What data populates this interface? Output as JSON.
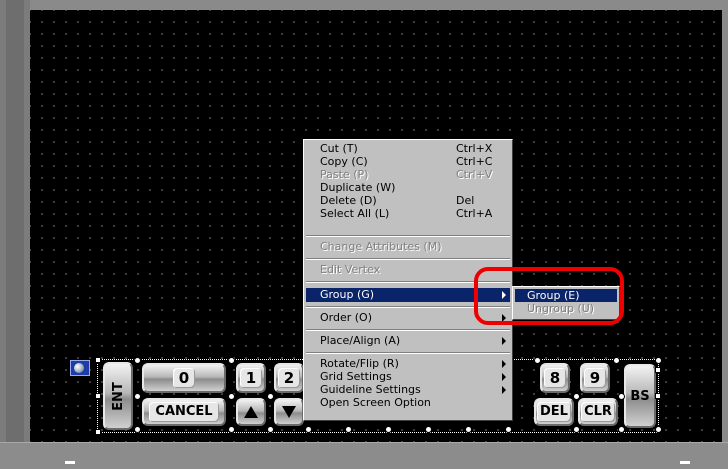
{
  "context_menu": {
    "items": [
      {
        "label": "Cut (T)",
        "shortcut": "Ctrl+X",
        "enabled": true
      },
      {
        "label": "Copy (C)",
        "shortcut": "Ctrl+C",
        "enabled": true
      },
      {
        "label": "Paste (P)",
        "shortcut": "Ctrl+V",
        "enabled": false
      },
      {
        "label": "Duplicate (W)",
        "shortcut": "",
        "enabled": true
      },
      {
        "label": "Delete (D)",
        "shortcut": "Del",
        "enabled": true
      },
      {
        "label": "Select All (L)",
        "shortcut": "Ctrl+A",
        "enabled": true
      },
      {
        "label": "Change Attributes (M)",
        "enabled": false
      },
      {
        "label": "Edit Vertex",
        "enabled": false
      },
      {
        "label": "Group (G)",
        "enabled": true,
        "highlighted": true,
        "submenu": true
      },
      {
        "label": "Order (O)",
        "enabled": true,
        "submenu": true
      },
      {
        "label": "Place/Align (A)",
        "enabled": true,
        "submenu": true
      },
      {
        "label": "Rotate/Flip (R)",
        "enabled": true,
        "submenu": true
      },
      {
        "label": "Grid Settings",
        "enabled": true,
        "submenu": true
      },
      {
        "label": "Guideline Settings",
        "enabled": true,
        "submenu": true
      },
      {
        "label": "Open Screen Option",
        "enabled": true
      }
    ]
  },
  "submenu": {
    "items": [
      {
        "label": "Group (E)",
        "enabled": true,
        "highlighted": true
      },
      {
        "label": "Ungroup (U)",
        "enabled": false
      }
    ]
  },
  "keypad": {
    "top_keys": [
      "0",
      "1",
      "2",
      "8",
      "9"
    ],
    "ent": "ENT",
    "cancel": "CANCEL",
    "bs": "BS",
    "del": "DEL",
    "clr": "CLR"
  },
  "colors": {
    "highlight": "#0a246a",
    "annotation_ring": "#ee0000",
    "canvas": "#000000"
  }
}
